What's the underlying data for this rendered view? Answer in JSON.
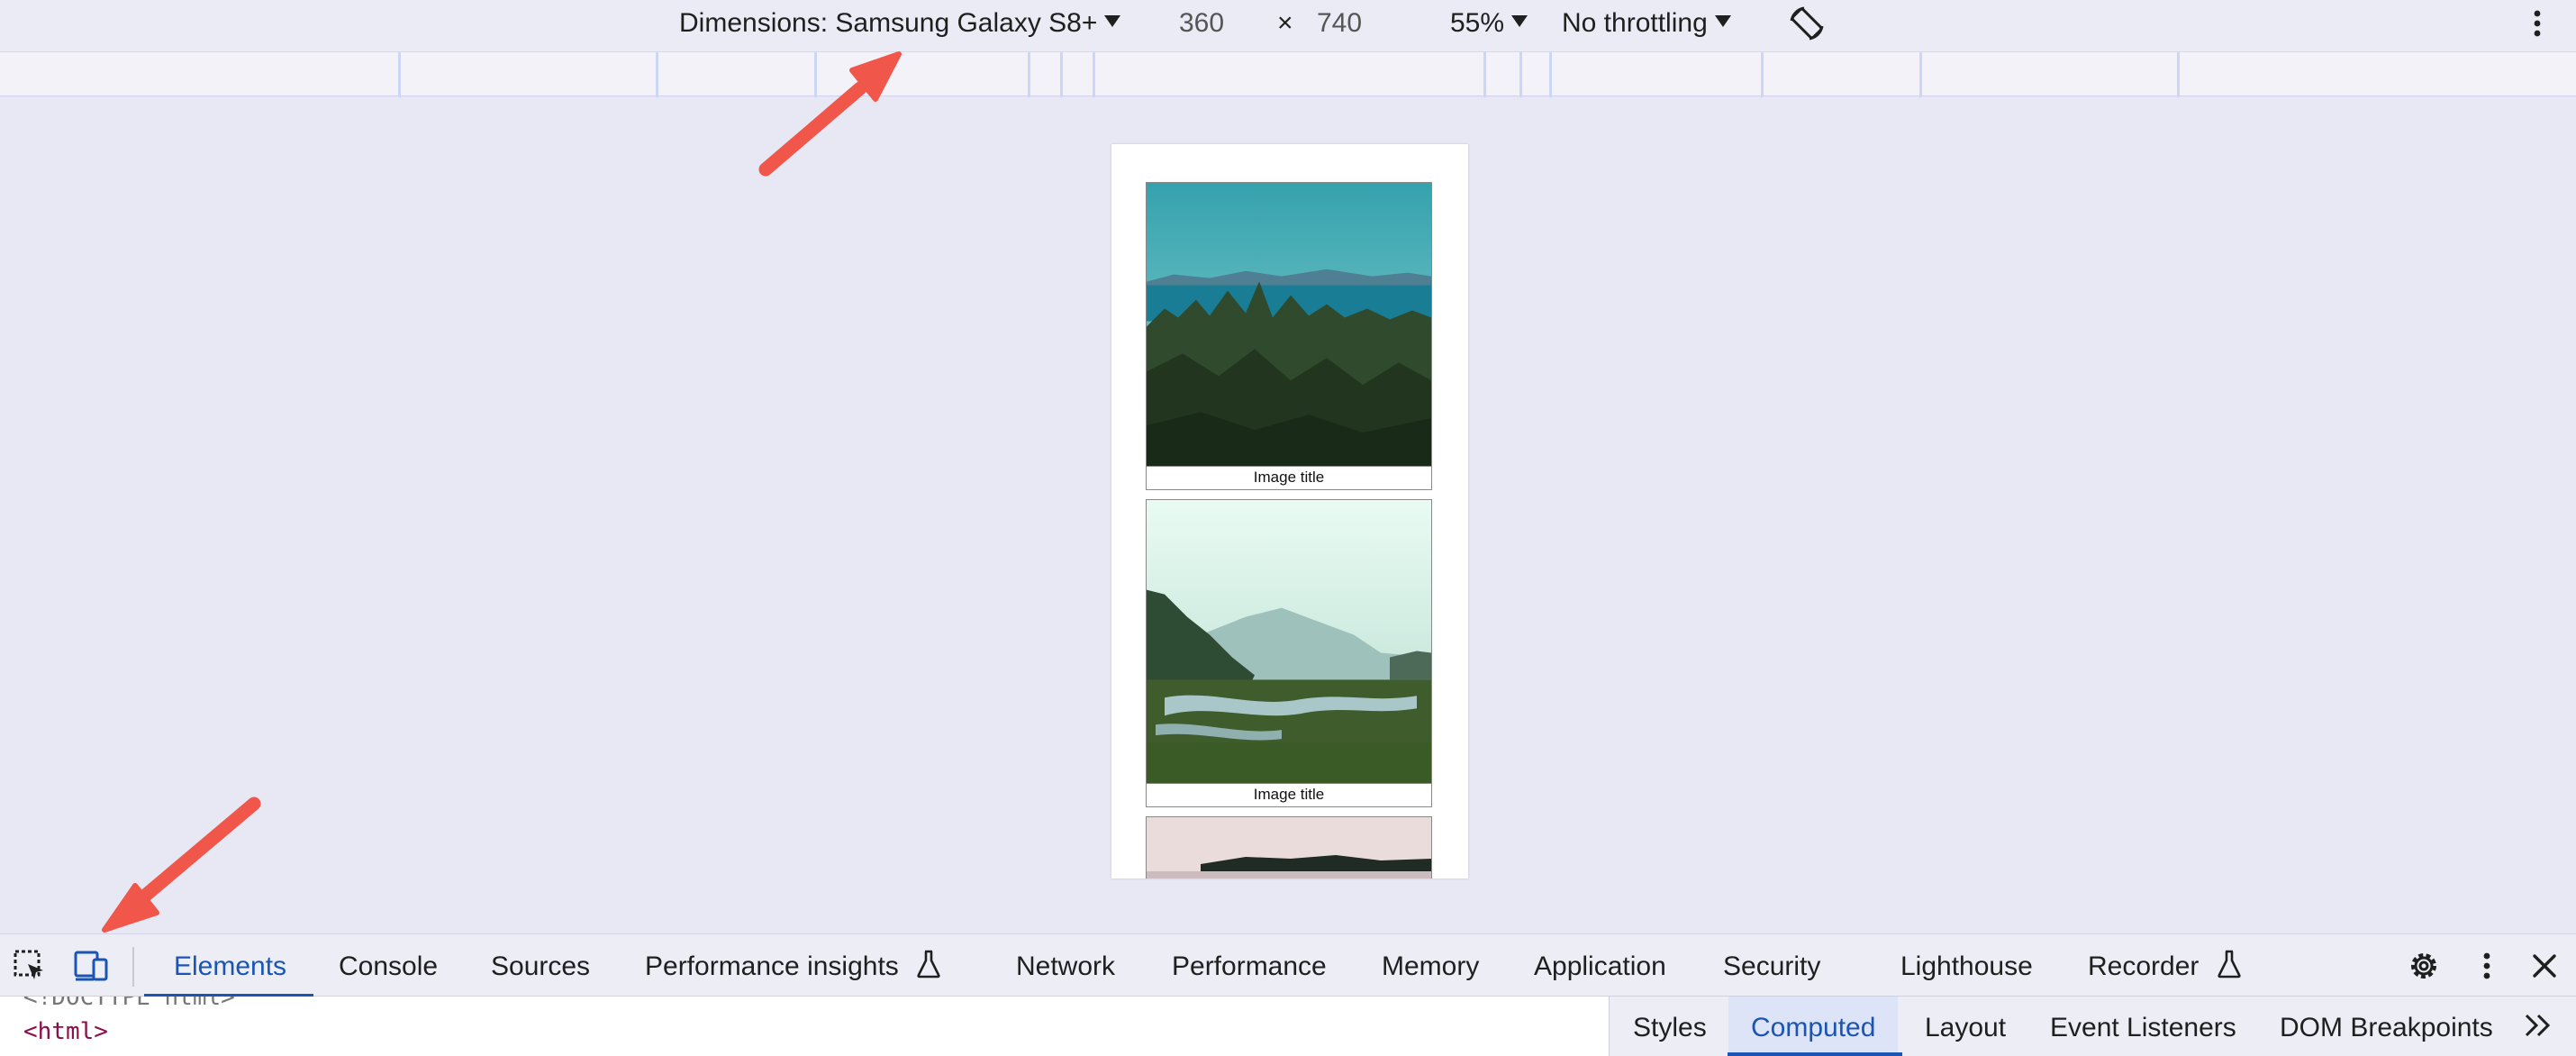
{
  "device_toolbar": {
    "dimensions_label": "Dimensions: Samsung Galaxy S8+",
    "width": "360",
    "times": "×",
    "height": "740",
    "zoom": "55%",
    "throttling": "No throttling",
    "icons": [
      "chevron-down-icon",
      "rotate-icon",
      "more-vert-icon"
    ]
  },
  "viewport": {
    "cards": [
      {
        "caption": "Image title"
      },
      {
        "caption": "Image title"
      },
      {
        "caption": ""
      }
    ]
  },
  "devtools": {
    "tabs": [
      {
        "label": "Elements",
        "active": true
      },
      {
        "label": "Console"
      },
      {
        "label": "Sources"
      },
      {
        "label": "Performance insights",
        "icon": "flask-icon"
      },
      {
        "label": "Network"
      },
      {
        "label": "Performance"
      },
      {
        "label": "Memory"
      },
      {
        "label": "Application"
      },
      {
        "label": "Security"
      },
      {
        "label": "Lighthouse"
      },
      {
        "label": "Recorder",
        "icon": "flask-icon"
      }
    ],
    "toolbar_icons": [
      "inspect-icon",
      "device-toggle-icon",
      "settings-icon",
      "more-vert-icon",
      "close-icon"
    ],
    "elements_code": [
      "<!DOCTYPE html>",
      "<html>"
    ],
    "sidebar_tabs": [
      {
        "label": "Styles"
      },
      {
        "label": "Computed",
        "active": true
      },
      {
        "label": "Layout"
      },
      {
        "label": "Event Listeners"
      },
      {
        "label": "DOM Breakpoints"
      }
    ],
    "overflow_icon": "chevron-double-right-icon"
  },
  "colors": {
    "accent": "#1a55b4",
    "arrow": "#f0574a",
    "background": "#e8e8f4",
    "tag": "#8b0f4a"
  }
}
